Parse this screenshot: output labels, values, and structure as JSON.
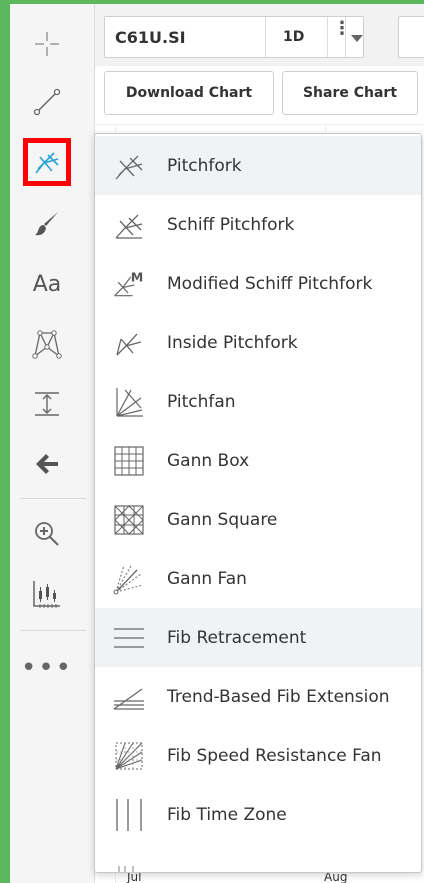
{
  "toolbar": {
    "items": [
      {
        "name": "crosshair-tool",
        "icon": "crosshair-icon"
      },
      {
        "name": "trend-line-tool",
        "icon": "trend-line-icon"
      },
      {
        "name": "pitchfork-tool",
        "icon": "pitchfork-icon",
        "selected": true
      },
      {
        "name": "brush-tool",
        "icon": "brush-icon"
      },
      {
        "name": "text-tool",
        "icon": "text-icon",
        "label": "Aa"
      },
      {
        "name": "pattern-tool",
        "icon": "pattern-icon"
      },
      {
        "name": "measure-tool",
        "icon": "measure-icon"
      },
      {
        "name": "arrow-tool",
        "icon": "arrow-left-icon"
      },
      {
        "name": "zoom-tool",
        "icon": "zoom-in-icon"
      },
      {
        "name": "chart-properties-tool",
        "icon": "chart-properties-icon"
      },
      {
        "name": "more-tools",
        "icon": "more-icon",
        "label": "•••"
      }
    ],
    "text_tool_label": "Aa",
    "more_label": "•••"
  },
  "header": {
    "symbol": "C61U.SI",
    "interval": "1D",
    "kebab": "⋮",
    "download_chart_label": "Download Chart",
    "share_chart_label": "Share Chart"
  },
  "axis": {
    "bottom_labels": [
      "Jul",
      "Aug"
    ]
  },
  "dropdown": {
    "items": [
      {
        "label": "Pitchfork",
        "icon": "pitchfork-icon"
      },
      {
        "label": "Schiff Pitchfork",
        "icon": "schiff-pitchfork-icon"
      },
      {
        "label": "Modified Schiff Pitchfork",
        "icon": "modified-schiff-pitchfork-icon"
      },
      {
        "label": "Inside Pitchfork",
        "icon": "inside-pitchfork-icon"
      },
      {
        "label": "Pitchfan",
        "icon": "pitchfan-icon"
      },
      {
        "label": "Gann Box",
        "icon": "gann-box-icon"
      },
      {
        "label": "Gann Square",
        "icon": "gann-square-icon"
      },
      {
        "label": "Gann Fan",
        "icon": "gann-fan-icon"
      },
      {
        "label": "Fib Retracement",
        "icon": "fib-retracement-icon",
        "hovered": true
      },
      {
        "label": "Trend-Based Fib Extension",
        "icon": "trend-fib-extension-icon"
      },
      {
        "label": "Fib Speed Resistance Fan",
        "icon": "fib-speed-fan-icon"
      },
      {
        "label": "Fib Time Zone",
        "icon": "fib-time-zone-icon"
      }
    ]
  },
  "colors": {
    "background_frame": "#5cb85c",
    "selected_outline": "#ff0000",
    "active_icon": "#29a3d6",
    "hover_row": "#f0f3f6"
  }
}
